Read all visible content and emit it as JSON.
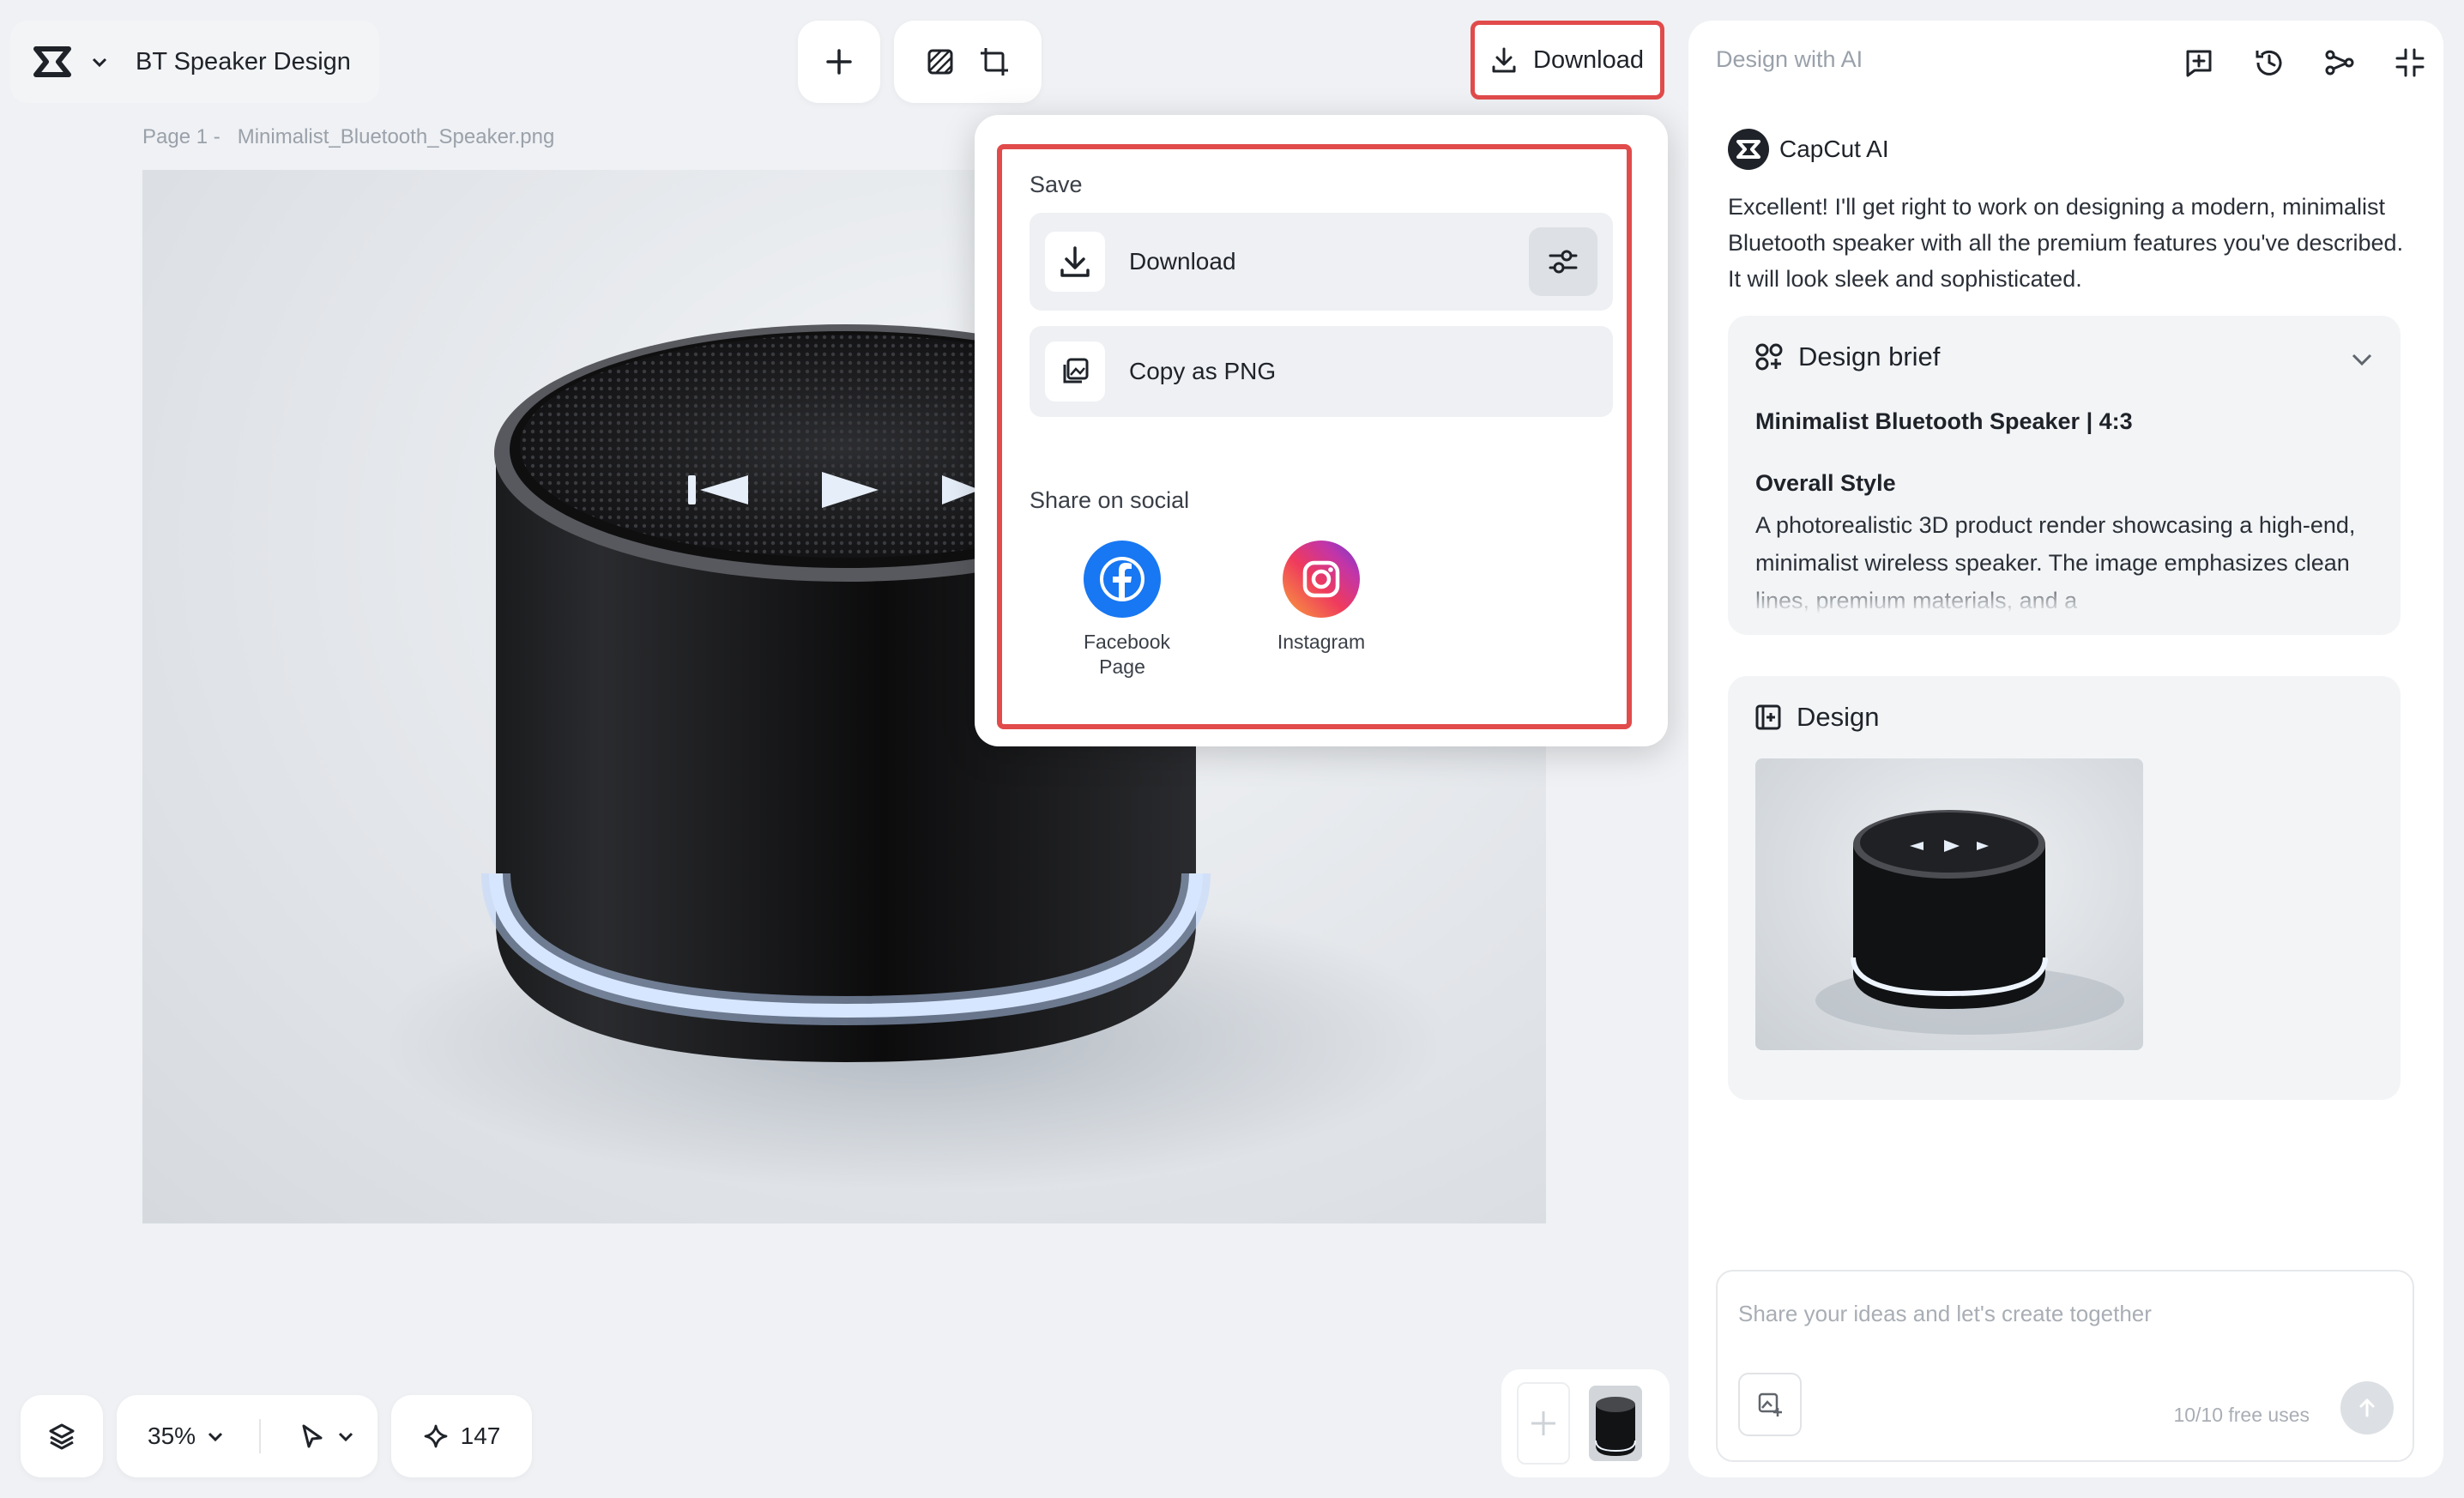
{
  "header": {
    "project_title": "BT Speaker Design",
    "download_label": "Download"
  },
  "canvas": {
    "breadcrumb": "Page 1 -   Minimalist_Bluetooth_Speaker.png"
  },
  "download_menu": {
    "save_heading": "Save",
    "download_label": "Download",
    "copy_label": "Copy as PNG",
    "share_heading": "Share on social",
    "facebook_label": "Facebook Page",
    "instagram_label": "Instagram"
  },
  "panel": {
    "title": "Design with AI",
    "ai_name": "CapCut AI",
    "ai_message": "Excellent! I'll get right to work on designing a modern, minimalist Bluetooth speaker with all the premium features you've described. It will look sleek and sophisticated.",
    "brief": {
      "title": "Design brief",
      "subtitle": "Minimalist Bluetooth Speaker | 4:3",
      "style_heading": "Overall Style",
      "style_text": "A photorealistic 3D product render showcasing a high-end, minimalist wireless speaker. The image emphasizes clean lines, premium materials, and a"
    },
    "design_title": "Design",
    "prompt_placeholder": "Share your ideas and let's create together",
    "free_uses": "10/10 free uses"
  },
  "bottom_bar": {
    "zoom": "35%",
    "credits": "147"
  },
  "colors": {
    "highlight": "#e14b4b",
    "facebook": "#1877f2",
    "background": "#eff1f4"
  }
}
